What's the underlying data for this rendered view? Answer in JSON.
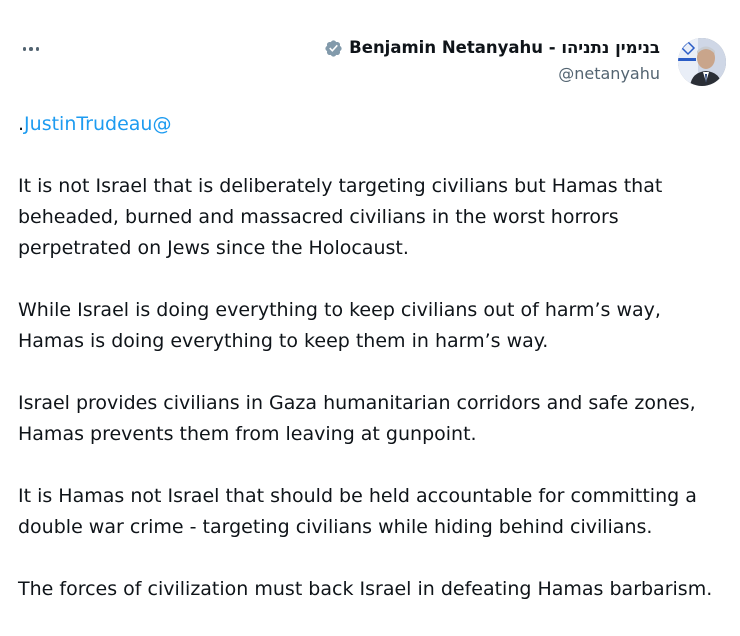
{
  "author": {
    "display_name": "Benjamin Netanyahu - בנימין נתניהו",
    "handle": "@netanyahu",
    "verified": true,
    "verified_color": "#829aab"
  },
  "tweet": {
    "mention": "@JustinTrudeau",
    "mention_suffix": ".",
    "paragraphs": [
      "It is not Israel that is deliberately targeting civilians but Hamas that beheaded, burned and massacred civilians in the worst horrors perpetrated on Jews since the Holocaust.",
      "While Israel is doing everything to keep civilians out of harm’s way, Hamas is doing everything to keep them in harm’s way.",
      "Israel provides civilians in Gaza humanitarian corridors and safe zones, Hamas prevents them from leaving at gunpoint.",
      "It is Hamas not Israel that should be held accountable for committing a double war crime - targeting civilians while hiding behind civilians.",
      "The forces of civilization must back Israel in defeating Hamas barbarism."
    ]
  },
  "icons": {
    "more": "more-horizontal-icon",
    "verified": "verified-badge-icon",
    "avatar": "profile-avatar"
  },
  "colors": {
    "link": "#1d9bf0",
    "secondary_text": "#536471",
    "primary_text": "#0f1419"
  }
}
